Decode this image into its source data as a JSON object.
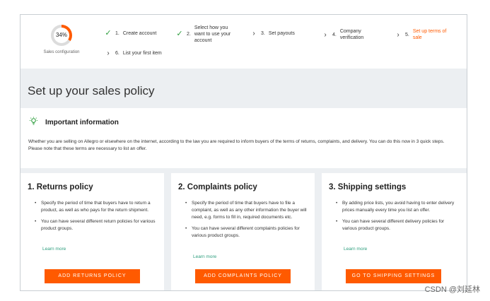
{
  "progress": {
    "percent_text": "34%",
    "label": "Sales configuration",
    "value": 0.34
  },
  "steps": [
    {
      "num": "1.",
      "label": "Create account",
      "state": "done"
    },
    {
      "num": "2.",
      "label": "Select how you want to use your account",
      "state": "done"
    },
    {
      "num": "3.",
      "label": "Set payouts",
      "state": "pending"
    },
    {
      "num": "4.",
      "label": "Company verification",
      "state": "pending"
    },
    {
      "num": "5.",
      "label": "Set up terms of sale",
      "state": "active"
    },
    {
      "num": "6.",
      "label": "List your first item",
      "state": "pending"
    }
  ],
  "page_title": "Set up your sales policy",
  "info": {
    "title": "Important information",
    "text": "Whether you are selling on Allegro or elsewhere on the internet, according to the law you are required to inform buyers of the terms of returns, complaints, and delivery. You can do this now in 3 quick steps. Please note that these terms are necessary to list an offer."
  },
  "cards": [
    {
      "title": "1. Returns policy",
      "bullets": [
        "Specify the period of time that buyers have to return a product, as well as who pays for the return shipment.",
        "You can have several different return policies for various product groups."
      ],
      "more": "Learn more",
      "button": "ADD RETURNS POLICY"
    },
    {
      "title": "2. Complaints policy",
      "bullets": [
        "Specify the period of time that buyers have to file a complaint, as well as any other information the buyer will need, e.g. forms to fill in, required documents etc.",
        "You can have several different complaints policies for various product groups."
      ],
      "more": "Learn more",
      "button": "ADD COMPLAINTS POLICY"
    },
    {
      "title": "3. Shipping settings",
      "bullets": [
        "By adding price lists, you avoid having to enter delivery prices manually every time you list an offer.",
        "You can have several different delivery policies for various product groups."
      ],
      "more": "Learn more",
      "button": "GO TO SHIPPING SETTINGS"
    }
  ],
  "watermark": "CSDN @刘延林",
  "colors": {
    "accent": "#ff5a00",
    "success": "#2e9e3e",
    "link": "#2e9e7e",
    "background": "#eceff2"
  },
  "icons": {
    "done": "check-icon",
    "pending": "chevron-right-icon",
    "info": "lightbulb-icon"
  }
}
